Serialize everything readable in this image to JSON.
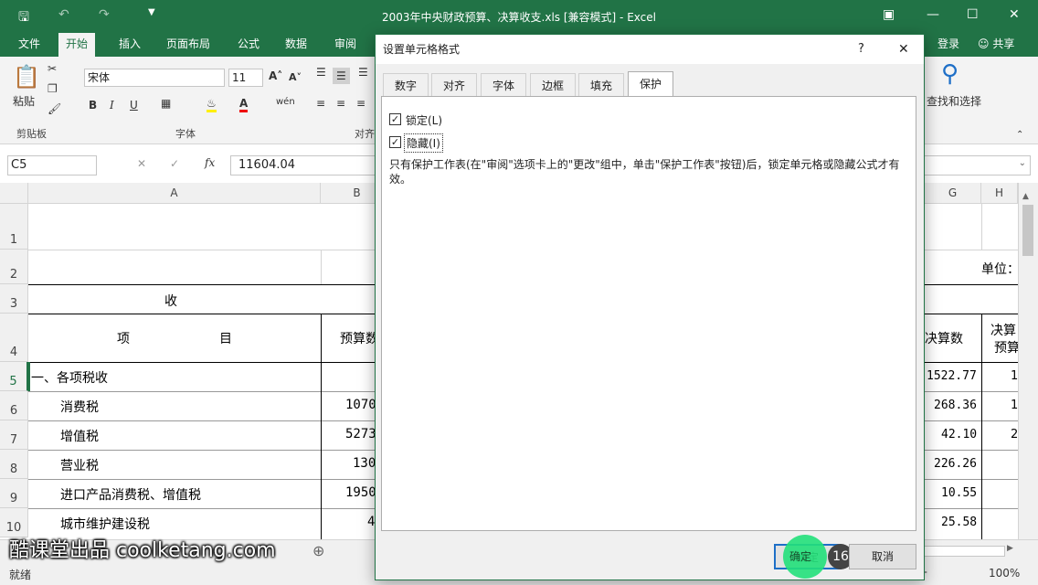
{
  "window": {
    "title": "2003年中央财政预算、决算收支.xls  [兼容模式] - Excel"
  },
  "ribbon_tabs": [
    "文件",
    "开始",
    "插入",
    "页面布局",
    "公式",
    "数据",
    "审阅"
  ],
  "ribbon_right": {
    "login": "登录",
    "share": "共享"
  },
  "ribbon": {
    "paste": "粘贴",
    "clipboard": "剪贴板",
    "font_group": "字体",
    "align_group": "对齐",
    "font_name": "宋体",
    "font_size": "11",
    "find_select": "查找和选择",
    "bold": "B",
    "italic": "I",
    "underline": "U"
  },
  "formula_bar": {
    "name_box": "C5",
    "value": "11604.04",
    "fx": "fx"
  },
  "columns": {
    "a": "A",
    "b": "B",
    "g": "G",
    "h": "H"
  },
  "rows": [
    "1",
    "2",
    "3",
    "4",
    "5",
    "6",
    "7",
    "8",
    "9",
    "10"
  ],
  "cells": {
    "unit": "单位：",
    "shou": "收",
    "xiang": "项",
    "mu": "目",
    "yusuan": "预算数",
    "juesuan": "决算数",
    "juesuan2": "决算",
    "yusuan2": "预算",
    "r5a": "一、各项税收",
    "r6a": "消费税",
    "r7a": "增值税",
    "r8a": "营业税",
    "r9a": "进口产品消费税、增值税",
    "r10a": "城市维护建设税",
    "r6b": "1070",
    "r7b": "5273",
    "r8b": "130",
    "r9b": "1950",
    "r10b": "4",
    "r5g": "1522.77",
    "r6g": "268.36",
    "r7g": "42.10",
    "r8g": "226.26",
    "r9g": "10.55",
    "r10g": "25.58",
    "r5h": "1",
    "r6h": "1",
    "r7h": "2"
  },
  "status": {
    "ready": "就绪",
    "zoom": "100%"
  },
  "dialog": {
    "title": "设置单元格格式",
    "help": "?",
    "close": "✕",
    "tabs": [
      "数字",
      "对齐",
      "字体",
      "边框",
      "填充",
      "保护"
    ],
    "locked": "锁定(L)",
    "hidden": "隐藏(I)",
    "note": "只有保护工作表(在\"审阅\"选项卡上的\"更改\"组中，单击\"保护工作表\"按钮)后，锁定单元格或隐藏公式才有效。",
    "ok": "确定",
    "cancel": "取消",
    "step": "16"
  },
  "watermark": "酷课堂出品 coolketang.com",
  "colors": {
    "excel_green": "#217346",
    "highlight": "#22e07a"
  }
}
